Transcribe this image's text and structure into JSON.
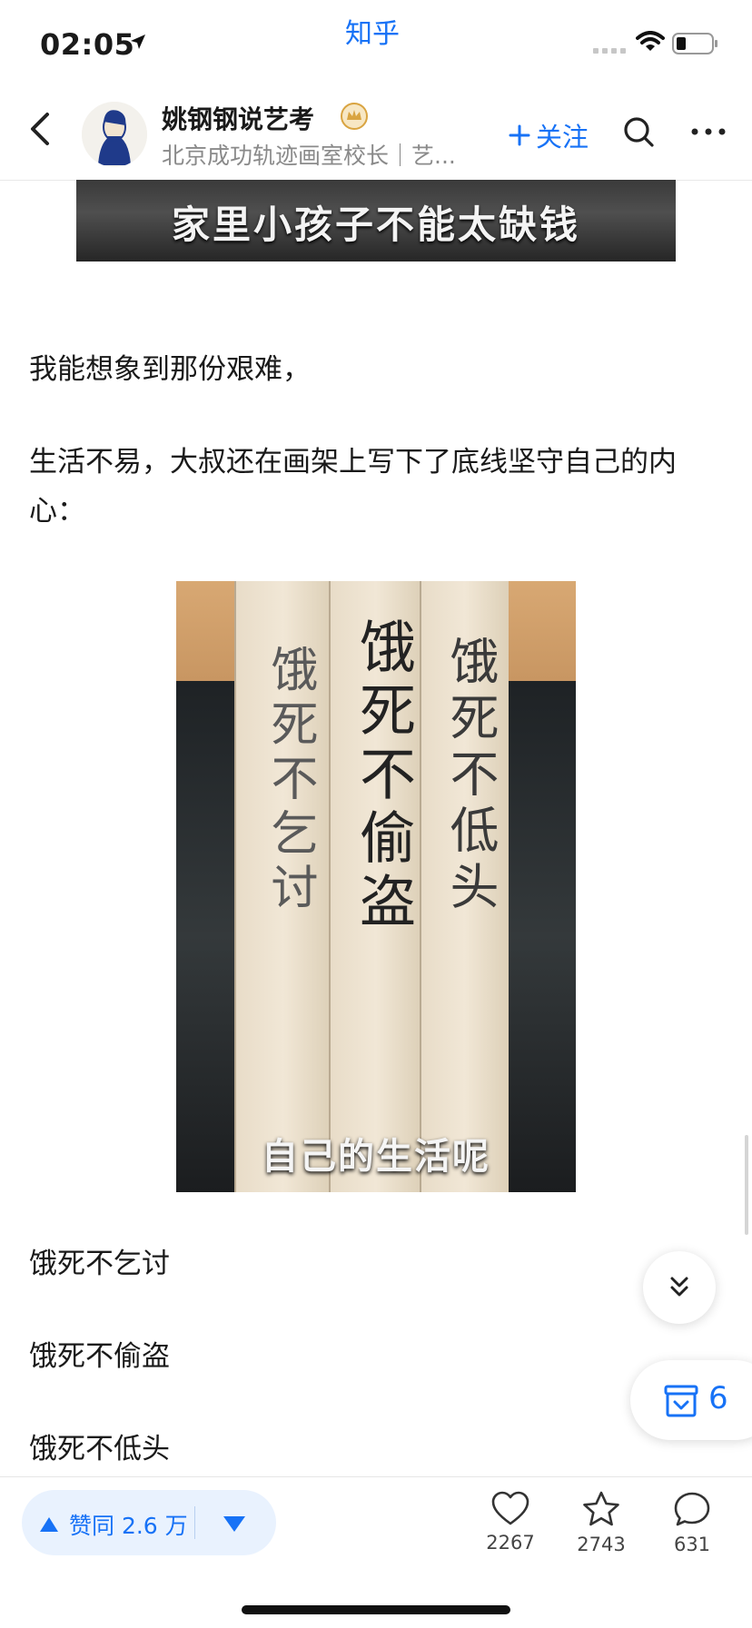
{
  "status_bar": {
    "time": "02:05",
    "app_title": "知乎",
    "signal_icon": "signal-icon",
    "wifi_icon": "wifi-icon",
    "battery_icon": "battery-icon"
  },
  "header": {
    "back_icon": "chevron-left-icon",
    "author_name": "姚钢钢说艺考",
    "author_subtitle": "北京成功轨迹画室校长｜艺...",
    "follow_label": "关注",
    "search_icon": "search-icon",
    "more_icon": "more-icon"
  },
  "content": {
    "top_image_caption": "家里小孩子不能太缺钱",
    "para1": "我能想象到那份艰难，",
    "para2": "生活不易，大叔还在画架上写下了底线坚守自己的内心：",
    "photo": {
      "board_left": "饿死不乞讨",
      "board_middle": "饿死不偷盗",
      "board_right": "饿死不低头",
      "caption": "自己的生活呢"
    },
    "line1": "饿死不乞讨",
    "line2": "饿死不偷盗",
    "line3": "饿死不低头"
  },
  "floating": {
    "collect_count": "6"
  },
  "bottom_bar": {
    "vote_up_label": "赞同 2.6 万",
    "like_count": "2267",
    "favorite_count": "2743",
    "comment_count": "631"
  },
  "colors": {
    "accent": "#1772f6",
    "vote_bg": "#e9f2fe",
    "text": "#1a1a1a",
    "muted": "#8a8a8a"
  }
}
